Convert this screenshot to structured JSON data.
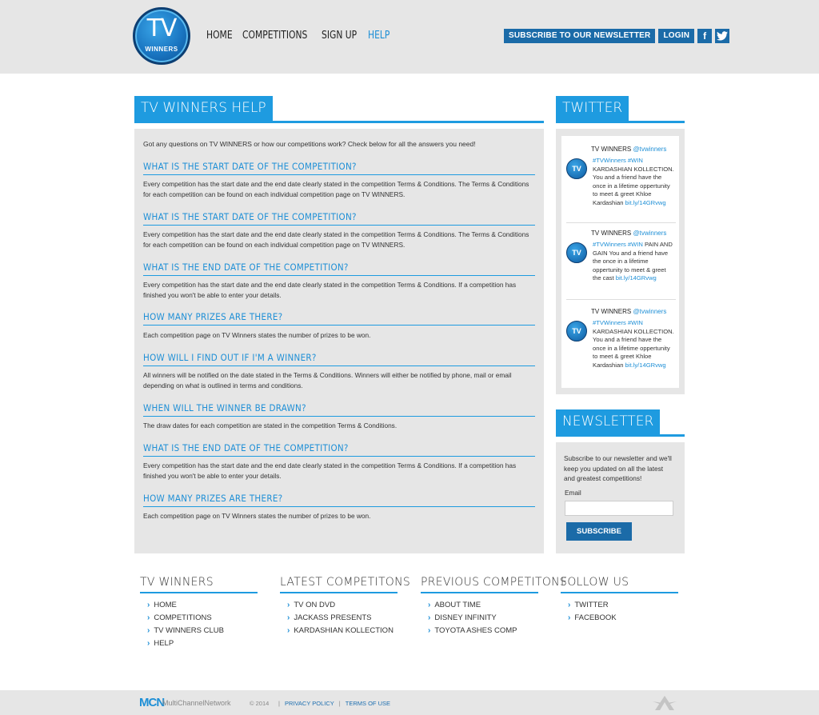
{
  "header": {
    "logo_main": "TV",
    "logo_sub": "WINNERS",
    "nav": [
      "HOME",
      "COMPETITIONS",
      "SIGN UP",
      "HELP"
    ],
    "subscribe_label": "SUBSCRIBE TO OUR NEWSLETTER",
    "login_label": "LOGIN",
    "facebook_glyph": "f",
    "twitter_glyph": "t"
  },
  "help": {
    "title": "TV WINNERS HELP",
    "intro": "Got any questions on TV WINNERS or how our competitions work? Check below for all the answers you need!",
    "faqs": [
      {
        "q": "WHAT IS THE START DATE OF THE COMPETITION?",
        "a": "Every competition has the start date and the end date clearly stated in the competition Terms & Conditions. The Terms & Conditions for each competition can be found on each individual competition page on TV WINNERS."
      },
      {
        "q": "WHAT IS THE START DATE OF THE COMPETITION?",
        "a": "Every competition has the start date and the end date clearly stated in the competition Terms & Conditions. The Terms & Conditions for each competition can be found on each individual competition page on TV WINNERS."
      },
      {
        "q": "WHAT IS THE END DATE OF THE COMPETITION?",
        "a": "Every competition has the start date and the end date clearly stated in the competition Terms & Conditions. If a competition has finished you won't be able to enter your details."
      },
      {
        "q": "HOW MANY PRIZES ARE THERE?",
        "a": "Each competition page on TV Winners states the number of prizes to be won."
      },
      {
        "q": "HOW WILL I FIND OUT IF I'M A WINNER?",
        "a": "All winners will be notified on the date stated in the Terms & Conditions. Winners will either be notified by phone, mail or email depending on what is outlined in terms and conditions."
      },
      {
        "q": "WHEN WILL THE WINNER BE DRAWN?",
        "a": "The draw dates for each competition are stated in the competition Terms & Conditions."
      },
      {
        "q": "WHAT IS THE END DATE OF THE COMPETITION?",
        "a": "Every competition has the start date and the end date clearly stated in the competition Terms & Conditions. If a competition has finished you won't be able to enter your details."
      },
      {
        "q": "HOW MANY PRIZES ARE THERE?",
        "a": "Each competition page on TV Winners states the number of prizes to be won."
      }
    ]
  },
  "twitter": {
    "title": "TWITTER",
    "tweets": [
      {
        "name": "TV WINNERS",
        "handle": "@tvwinners",
        "tags": "#TVWinners #WIN",
        "text": "KARDASHIAN KOLLECTION. You and a friend have the once in a lifetime oppertunity to meet & greet Khloe Kardashian",
        "link": "bit.ly/14GRvwg"
      },
      {
        "name": "TV WINNERS",
        "handle": "@tvwinners",
        "tags": "#TVWinners #WIN",
        "text": "PAIN AND GAIN You and a friend have the once in a lifetime oppertunity to meet & greet the cast",
        "link": "bit.ly/14GRvwg"
      },
      {
        "name": "TV WINNERS",
        "handle": "@tvwinners",
        "tags": "#TVWinners #WIN",
        "text": "KARDASHIAN KOLLECTION. You and a friend have the once in a lifetime oppertunity to meet & greet Khloe Kardashian",
        "link": "bit.ly/14GRvwg"
      }
    ]
  },
  "newsletter": {
    "title": "NEWSLETTER",
    "text": "Subscribe to our newsletter and we'll keep you updated on all the latest and greatest competitions!",
    "email_label": "Email",
    "email_value": "",
    "button": "SUBSCRIBE"
  },
  "footer": {
    "columns": [
      {
        "title": "TV WINNERS",
        "items": [
          "HOME",
          "COMPETITIONS",
          "TV WINNERS CLUB",
          "HELP"
        ]
      },
      {
        "title": "LATEST COMPETITONS",
        "items": [
          "TV ON DVD",
          "JACKASS PRESENTS",
          "KARDASHIAN KOLLECTION"
        ]
      },
      {
        "title": "PREVIOUS COMPETITONS",
        "items": [
          "ABOUT TIME",
          "DISNEY INFINITY",
          "TOYOTA ASHES COMP"
        ]
      },
      {
        "title": "FOLLOW US",
        "items": [
          "TWITTER",
          "FACEBOOK"
        ]
      }
    ],
    "mcn": "MCN",
    "mcn_name": "MultiChannelNetwork",
    "copyright": "© 2014",
    "privacy": "PRIVACY POLICY",
    "terms": "TERMS OF USE",
    "divider": "|"
  }
}
